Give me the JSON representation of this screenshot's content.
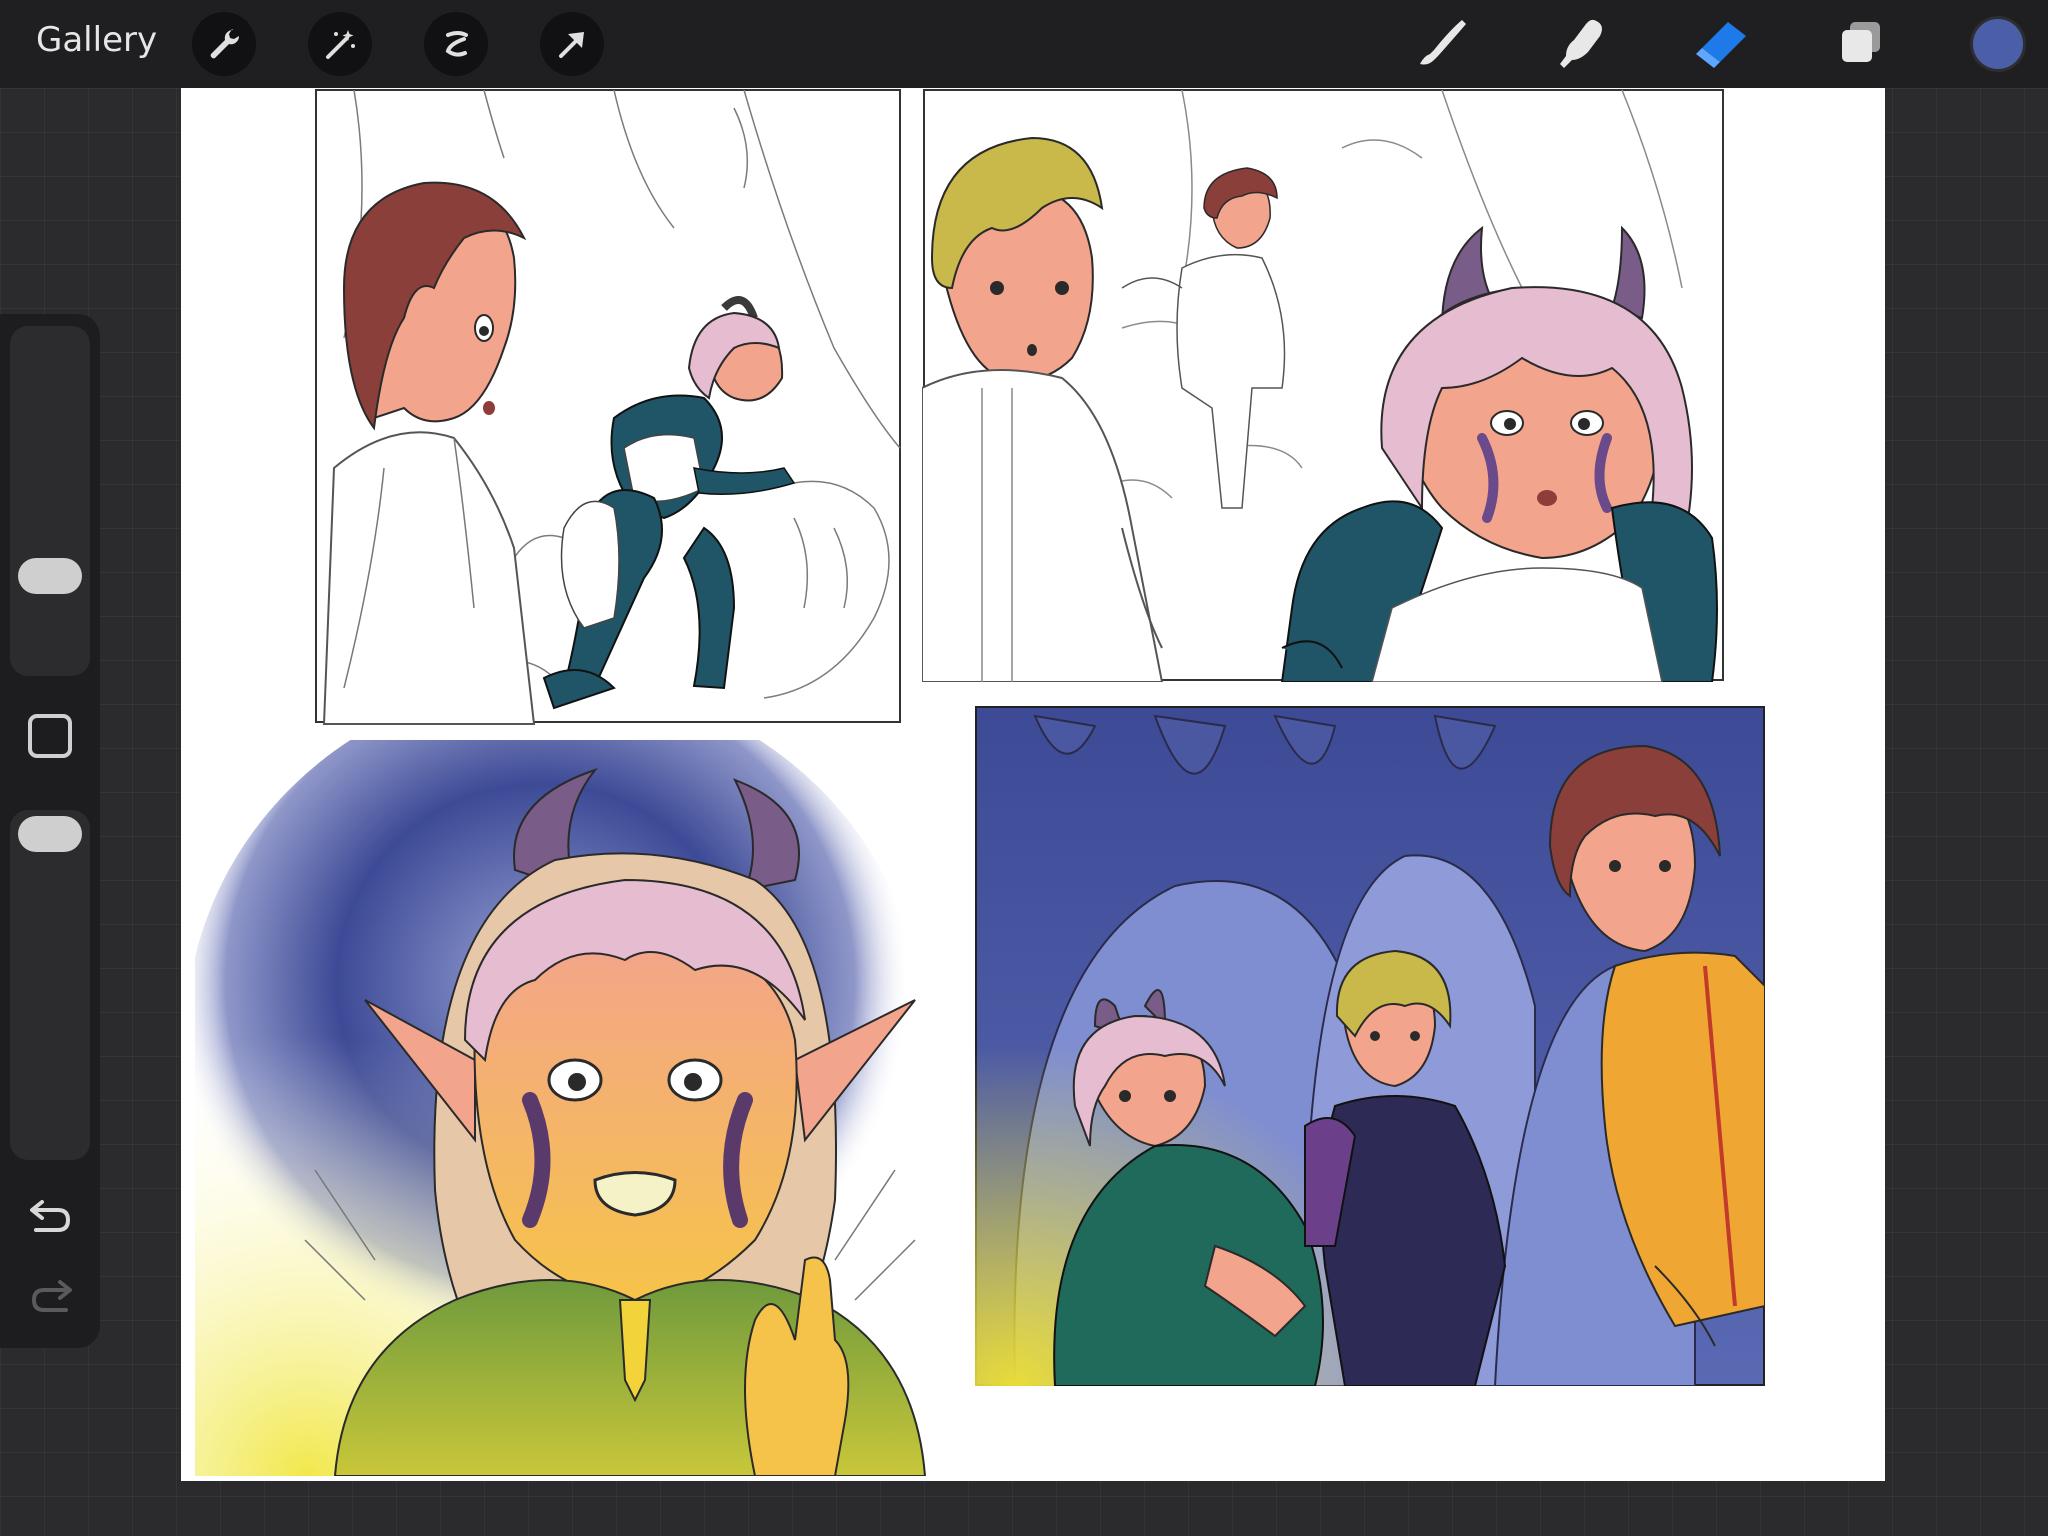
{
  "toolbar": {
    "gallery_label": "Gallery",
    "left_tools": [
      "wrench-icon",
      "magic-wand-icon",
      "selection-icon",
      "transform-arrow-icon"
    ],
    "right_tools": [
      "brush-icon",
      "smudge-icon",
      "eraser-icon",
      "layers-icon"
    ],
    "active_tool": "eraser-icon",
    "active_color": "#4a5fa8",
    "active_tool_color": "#1e7ae8"
  },
  "sidebar": {
    "tools": [
      "brush-size-slider",
      "modify-button",
      "opacity-slider",
      "undo-icon",
      "redo-icon"
    ]
  },
  "artwork": {
    "description_colors": {
      "cave_blue": "#3d4a96",
      "hair_brown": "#8b3f3a",
      "hair_blonde": "#c9b84a",
      "hair_pink": "#e6bcd0",
      "armor_teal": "#1f5567",
      "skin": "#f3a48c",
      "glow_yellow": "#e9dc3a",
      "jacket_orange": "#f0a632"
    }
  }
}
